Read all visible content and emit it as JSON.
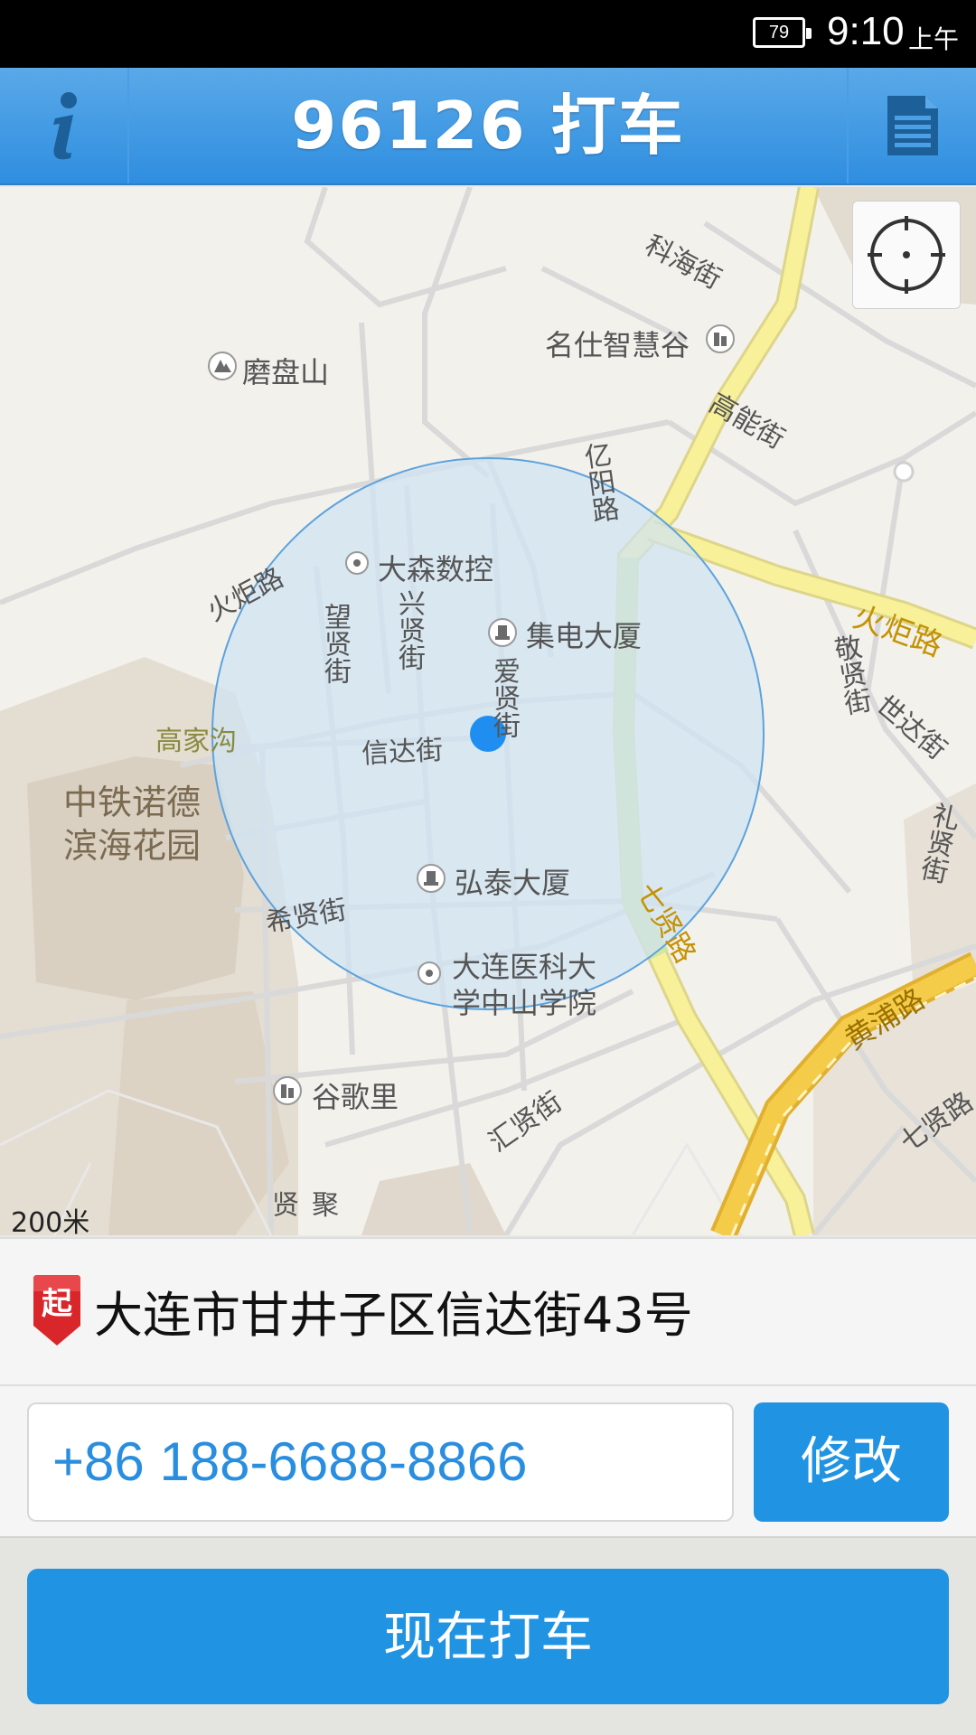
{
  "status_bar": {
    "battery": "79",
    "time": "9:10",
    "ampm": "上午"
  },
  "header": {
    "title": "96126 打车",
    "info_icon": "info-icon",
    "menu_icon": "document-icon"
  },
  "map": {
    "labels": {
      "kehai": "科海街",
      "mingshi": "名仕智慧谷",
      "gaoneng": "高能街",
      "mopan": "磨盘山",
      "yiyang": "亿阳路",
      "dasen": "大森数控",
      "huoju_left": "火炬路",
      "huoju_right": "火炬路",
      "wangxian": "望贤街",
      "xingxian": "兴贤街",
      "jidian": "集电大厦",
      "aixian": "爱贤街",
      "jingxian": "敬贤街",
      "shida": "世达街",
      "gaojiagou": "高家沟",
      "xinda": "信达街",
      "zhongtie_1": "中铁诺德",
      "zhongtie_2": "滨海花园",
      "lixian": "礼贤街",
      "hongtai": "弘泰大厦",
      "qixian_road": "七贤路",
      "xixian": "希贤街",
      "yike_1": "大连医科大",
      "yike_2": "学中山学院",
      "huangpu": "黄浦路",
      "guge": "谷歌里",
      "huixian": "汇贤街",
      "qixian_road2": "七贤路",
      "juxian": "聚贤"
    },
    "scale": "200米",
    "locate_icon": "crosshair-icon"
  },
  "start": {
    "badge": "起",
    "address": "大连市甘井子区信达街43号"
  },
  "phone": {
    "value": "+86 188-6688-8866",
    "modify_label": "修改"
  },
  "action": {
    "call_label": "现在打车"
  },
  "colors": {
    "primary": "#2193e3",
    "header": "#3a96e2",
    "accuracy_circle": "#cfe3f3",
    "major_road": "#f7ef8f",
    "express_road": "#f4c842"
  }
}
